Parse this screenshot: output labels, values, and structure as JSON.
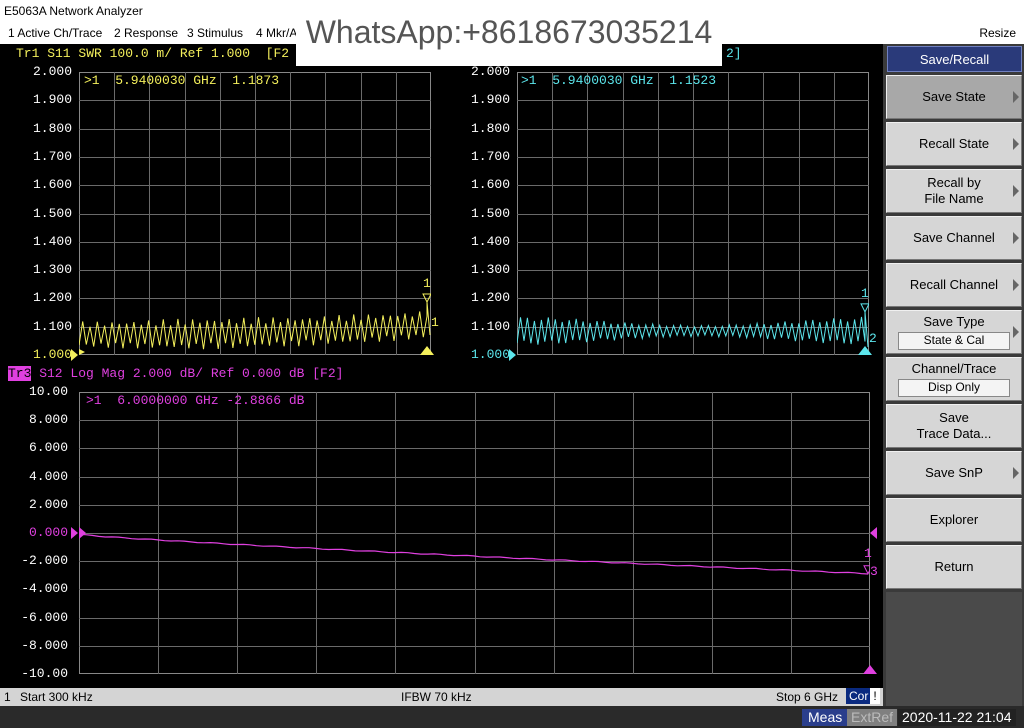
{
  "window": {
    "title": "E5063A Network Analyzer",
    "resize": "Resize"
  },
  "menu": [
    "1 Active Ch/Trace",
    "2 Response",
    "3 Stimulus",
    "4 Mkr/A"
  ],
  "watermark": "WhatsApp:+8618673035214",
  "colors": {
    "tr1": "#f4f05c",
    "tr2": "#5ce6ec",
    "tr3": "#e040e0",
    "grid": "#6a6a6a",
    "header": "#2a3a7a"
  },
  "traces": [
    {
      "title": "Tr1 S11 SWR 100.0 m/ Ref 1.000  [F2",
      "yticks": [
        "2.000",
        "1.900",
        "1.800",
        "1.700",
        "1.600",
        "1.500",
        "1.400",
        "1.300",
        "1.200",
        "1.100",
        "1.000"
      ],
      "marker": ">1  5.9400030 GHz  1.1873",
      "marker_tag": "1",
      "end_tag": "1"
    },
    {
      "title": "2]",
      "yticks": [
        "2.000",
        "1.900",
        "1.800",
        "1.700",
        "1.600",
        "1.500",
        "1.400",
        "1.300",
        "1.200",
        "1.100",
        "1.000"
      ],
      "marker": ">1  5.9400030 GHz  1.1523",
      "marker_tag": "1",
      "end_tag": "2"
    },
    {
      "badge": "Tr3",
      "title": " S12 Log Mag 2.000 dB/ Ref 0.000 dB [F2]",
      "yticks": [
        "10.00",
        "8.000",
        "6.000",
        "4.000",
        "2.000",
        "0.000",
        "-2.000",
        "-4.000",
        "-6.000",
        "-8.000",
        "-10.00"
      ],
      "marker": ">1  6.0000000 GHz -2.8866 dB",
      "marker_tag": "1",
      "end_tag": "3"
    }
  ],
  "status": {
    "channel": "1",
    "start": "Start 300 kHz",
    "ifbw": "IFBW 70 kHz",
    "stop": "Stop 6 GHz",
    "cor": "Cor",
    "bang": "!"
  },
  "bottom": {
    "meas": "Meas",
    "extref": "ExtRef",
    "clock": "2020-11-22 21:04"
  },
  "softkeys": {
    "header": "Save/Recall",
    "items": [
      {
        "label": "Save State",
        "arrow": true
      },
      {
        "label": "Recall State",
        "arrow": true
      },
      {
        "label": "Recall by",
        "label2": "File Name",
        "arrow": true
      },
      {
        "label": "Save Channel",
        "arrow": true
      },
      {
        "label": "Recall Channel",
        "arrow": true
      },
      {
        "label": "Save Type",
        "value": "State & Cal",
        "arrow": true
      },
      {
        "label": "Channel/Trace",
        "value": "Disp Only",
        "arrow": false
      },
      {
        "label": "Save",
        "label2": "Trace Data...",
        "arrow": false
      },
      {
        "label": "Save SnP",
        "arrow": true
      },
      {
        "label": "Explorer",
        "arrow": false
      },
      {
        "label": "Return",
        "arrow": false
      }
    ]
  }
}
